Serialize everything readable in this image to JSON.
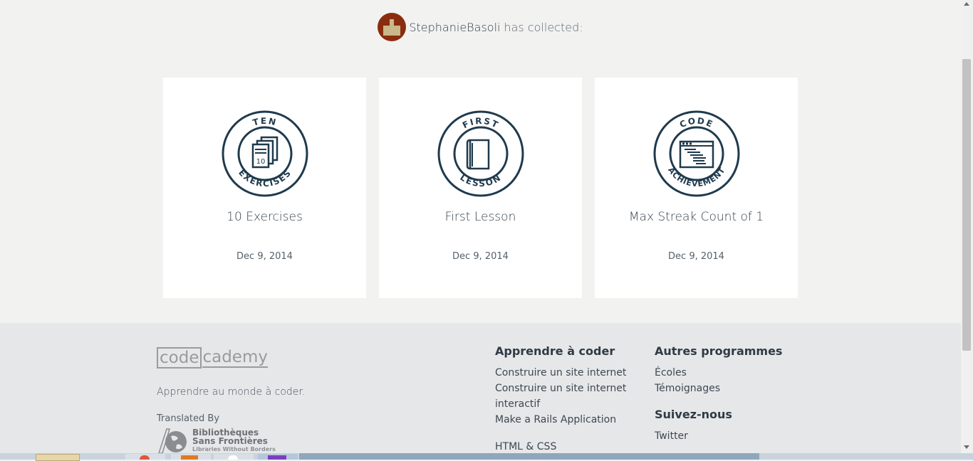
{
  "collector": {
    "username": "StephanieBasoli",
    "suffix": "has collected:"
  },
  "badges": [
    {
      "icon": "ten-exercises-badge",
      "ring_top": "TEN",
      "ring_bottom": "EXERCISES",
      "inner_text": "10",
      "title": "10 Exercises",
      "date": "Dec 9, 2014"
    },
    {
      "icon": "first-lesson-badge",
      "ring_top": "FIRST",
      "ring_bottom": "LESSON",
      "title": "First Lesson",
      "date": "Dec 9, 2014"
    },
    {
      "icon": "code-achievement-badge",
      "ring_top": "CODE",
      "ring_bottom": "ACHIEVEMENT",
      "title": "Max Streak Count of 1",
      "date": "Dec 9, 2014"
    }
  ],
  "footer": {
    "logo_boxed": "code",
    "logo_tail": "cademy",
    "tagline": "Apprendre au monde à coder.",
    "translated_by": "Translated By",
    "partner": {
      "line1": "Bibliothèques",
      "line2": "Sans Frontières",
      "line3": "Libraries Without Borders"
    },
    "learn": {
      "heading": "Apprendre à coder",
      "links": [
        "Construire un site internet",
        "Construire un site internet interactif",
        "Make a Rails Application"
      ],
      "more": "HTML & CSS"
    },
    "programs": {
      "heading": "Autres programmes",
      "links": [
        "Écoles",
        "Témoignages"
      ]
    },
    "follow": {
      "heading": "Suivez-nous",
      "links": [
        "Twitter"
      ]
    }
  },
  "colors": {
    "badge_navy": "#1f3a4d",
    "card_bg": "#ffffff",
    "page_bg": "#f2f2f1",
    "footer_bg": "#e6e7e8"
  }
}
